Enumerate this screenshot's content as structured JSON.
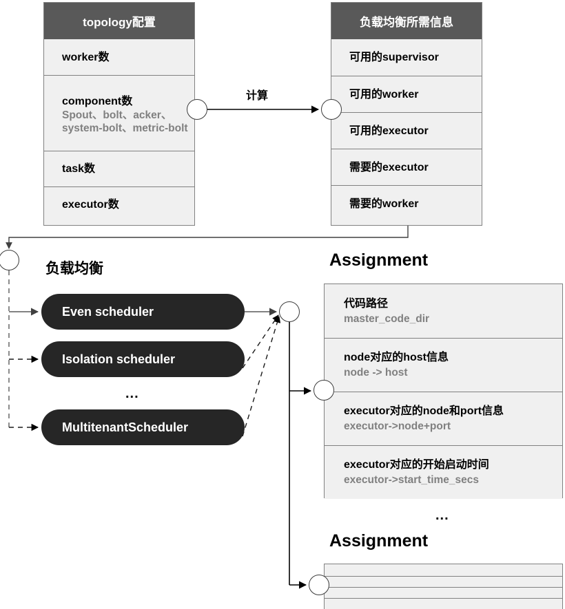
{
  "diagram": {
    "title_labels": {
      "compute": "计算",
      "load_balance": "负载均衡",
      "assignment_1": "Assignment",
      "assignment_2": "Assignment",
      "ellipsis_schedulers": "...",
      "ellipsis_assignments": "..."
    }
  },
  "table_topology": {
    "header": "topology配置",
    "rows": [
      {
        "main": "worker数",
        "sub": ""
      },
      {
        "main": "component数",
        "sub": "Spout、bolt、acker、system-bolt、metric-bolt"
      },
      {
        "main": "task数",
        "sub": ""
      },
      {
        "main": "executor数",
        "sub": ""
      }
    ]
  },
  "table_lbinfo": {
    "header": "负载均衡所需信息",
    "rows": [
      "可用的supervisor",
      "可用的worker",
      "可用的executor",
      "需要的executor",
      "需要的worker"
    ]
  },
  "schedulers": [
    {
      "label": "Even scheduler"
    },
    {
      "label": "Isolation scheduler"
    },
    {
      "label": "MultitenantScheduler"
    }
  ],
  "table_assignment": {
    "title": "Assignment",
    "rows": [
      {
        "main": "代码路径",
        "sub": "master_code_dir"
      },
      {
        "main": "node对应的host信息",
        "sub": "node -> host"
      },
      {
        "main": "executor对应的node和port信息",
        "sub": "executor->node+port"
      },
      {
        "main": "executor对应的开始启动时间",
        "sub": "executor->start_time_secs"
      }
    ]
  },
  "table_assignment_2": {
    "title": "Assignment",
    "rows": [
      "",
      "",
      "",
      ""
    ]
  },
  "colors": {
    "header_bg": "#595959",
    "row_bg": "#f0f0f0",
    "border": "#808080",
    "pill_bg": "#262626",
    "sub_text": "#808080",
    "main_text": "#000000",
    "canvas_bg": "#ffffff"
  }
}
